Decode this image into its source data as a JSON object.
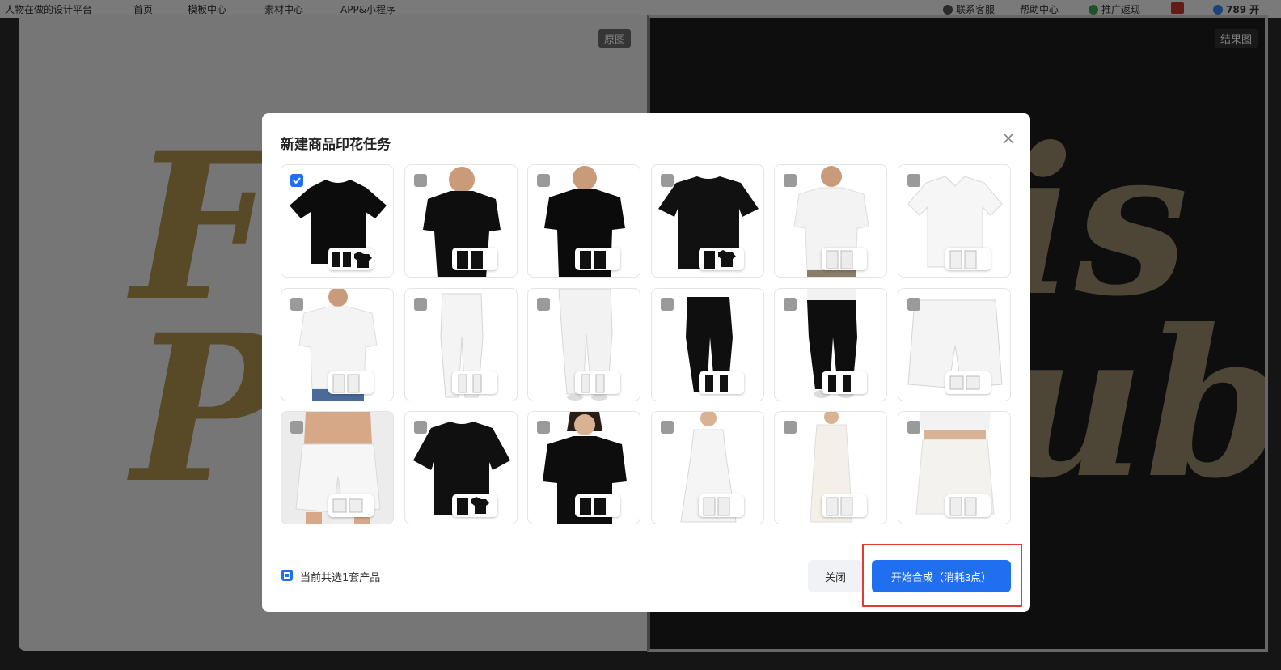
{
  "topbar": {
    "brand": "人物在做的设计平台",
    "nav": [
      "首页",
      "模板中心",
      "素材中心",
      "APP&小程序"
    ],
    "contact": "联系客服",
    "help": "帮助中心",
    "promo": "推广返现",
    "points": "789",
    "extra": "开"
  },
  "editor": {
    "left_tag": "原图",
    "right_tag": "结果图",
    "left_art": "Fr Pl",
    "right_art": "is ub"
  },
  "modal": {
    "title": "新建商品印花任务",
    "close_icon": "close-icon",
    "items": [
      {
        "name": "black-tshirt-flat",
        "checked": true
      },
      {
        "name": "black-tshirt-model-male",
        "checked": false
      },
      {
        "name": "black-tshirt-model-male-2",
        "checked": false
      },
      {
        "name": "black-oversize-tshirt-flat",
        "checked": false
      },
      {
        "name": "white-tshirt-model-male",
        "checked": false
      },
      {
        "name": "white-polo-flat",
        "checked": false
      },
      {
        "name": "white-polo-model-male",
        "checked": false
      },
      {
        "name": "white-pants-flat",
        "checked": false
      },
      {
        "name": "white-pants-model",
        "checked": false
      },
      {
        "name": "black-pants-flat",
        "checked": false
      },
      {
        "name": "black-pants-model",
        "checked": false
      },
      {
        "name": "white-shorts-flat",
        "checked": false
      },
      {
        "name": "white-shorts-model",
        "checked": false
      },
      {
        "name": "black-oversize-tshirt-flat-2",
        "checked": false
      },
      {
        "name": "black-tshirt-model-female",
        "checked": false
      },
      {
        "name": "white-dress-sleeveless",
        "checked": false
      },
      {
        "name": "white-slip-dress-model",
        "checked": false
      },
      {
        "name": "white-skirt-model",
        "checked": false
      }
    ],
    "footer": {
      "selected_text": "当前共选1套产品",
      "close_label": "关闭",
      "start_label": "开始合成（消耗3点）"
    }
  },
  "colors": {
    "accent": "#1f6ff0",
    "highlight": "#e53935"
  }
}
